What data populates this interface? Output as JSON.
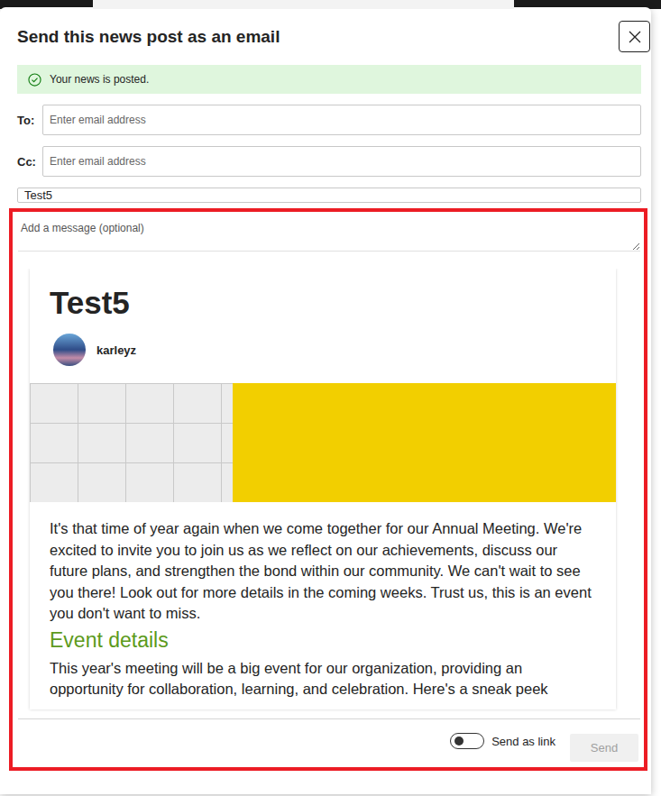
{
  "dialog": {
    "title": "Send this news post as an email",
    "close_label": "Close"
  },
  "notice": {
    "text": "Your news is posted."
  },
  "fields": [
    {
      "label": "To:",
      "placeholder": "Enter email address",
      "value": ""
    },
    {
      "label": "Cc:",
      "placeholder": "Enter email address",
      "value": ""
    }
  ],
  "subject": {
    "value": "Test5"
  },
  "message": {
    "placeholder": "Add a message (optional)"
  },
  "preview": {
    "title": "Test5",
    "author": "karleyz",
    "blocks": [
      {
        "kind": "paragraph",
        "text": "It's that time of year again when we come together for our Annual Meeting. We're excited to invite you to join us as we reflect on our achievements, discuss our future plans, and strengthen the bond within our community. We can't wait to see you there! Look out for more details in the coming weeks. Trust us, this is an event you don't want to miss."
      },
      {
        "kind": "heading",
        "text": "Event details"
      },
      {
        "kind": "paragraph",
        "text": "This year's meeting will be a big event for our organization, providing an opportunity for collaboration, learning, and celebration. Here's a sneak peek"
      }
    ]
  },
  "footer": {
    "toggle": {
      "label": "Send as link",
      "on": false
    },
    "send": {
      "label": "Send",
      "disabled": true
    }
  }
}
